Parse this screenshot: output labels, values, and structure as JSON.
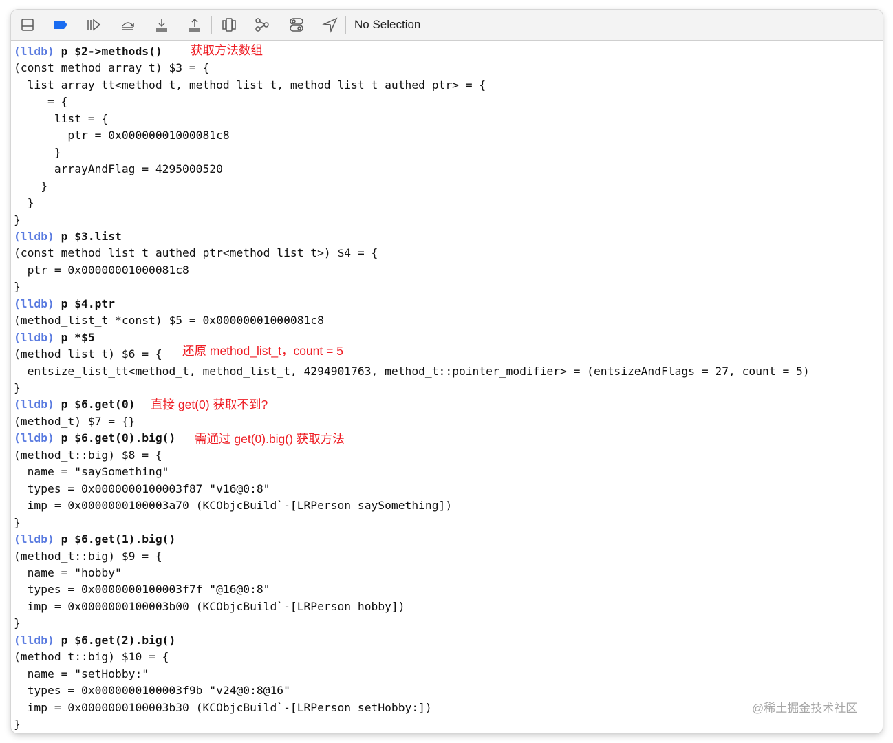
{
  "toolbar": {
    "status": "No Selection",
    "icons": [
      "hide-debug-area-icon",
      "breakpoints-toggle-icon",
      "continue-icon",
      "step-over-icon",
      "step-into-icon",
      "step-out-icon",
      "view-hierarchy-icon",
      "memory-graph-icon",
      "environment-overrides-icon",
      "simulate-location-icon"
    ]
  },
  "console": {
    "lines": [
      {
        "prompt": "(lldb)",
        "cmd": "p $2->methods()"
      },
      {
        "text": "(const method_array_t) $3 = {"
      },
      {
        "text": "  list_array_tt<method_t, method_list_t, method_list_t_authed_ptr> = {"
      },
      {
        "text": "     = {"
      },
      {
        "text": "      list = {"
      },
      {
        "text": "        ptr = 0x00000001000081c8"
      },
      {
        "text": "      }"
      },
      {
        "text": "      arrayAndFlag = 4295000520"
      },
      {
        "text": "    }"
      },
      {
        "text": "  }"
      },
      {
        "text": "}"
      },
      {
        "prompt": "(lldb)",
        "cmd": "p $3.list"
      },
      {
        "text": "(const method_list_t_authed_ptr<method_list_t>) $4 = {"
      },
      {
        "text": "  ptr = 0x00000001000081c8"
      },
      {
        "text": "}"
      },
      {
        "prompt": "(lldb)",
        "cmd": "p $4.ptr"
      },
      {
        "text": "(method_list_t *const) $5 = 0x00000001000081c8"
      },
      {
        "prompt": "(lldb)",
        "cmd": "p *$5"
      },
      {
        "text": "(method_list_t) $6 = {"
      },
      {
        "text": "  entsize_list_tt<method_t, method_list_t, 4294901763, method_t::pointer_modifier> = (entsizeAndFlags = 27, count = 5)"
      },
      {
        "text": "}"
      },
      {
        "prompt": "(lldb)",
        "cmd": "p $6.get(0)"
      },
      {
        "text": "(method_t) $7 = {}"
      },
      {
        "prompt": "(lldb)",
        "cmd": "p $6.get(0).big()"
      },
      {
        "text": "(method_t::big) $8 = {"
      },
      {
        "text": "  name = \"saySomething\""
      },
      {
        "text": "  types = 0x0000000100003f87 \"v16@0:8\""
      },
      {
        "text": "  imp = 0x0000000100003a70 (KCObjcBuild`-[LRPerson saySomething])"
      },
      {
        "text": "}"
      },
      {
        "prompt": "(lldb)",
        "cmd": "p $6.get(1).big()"
      },
      {
        "text": "(method_t::big) $9 = {"
      },
      {
        "text": "  name = \"hobby\""
      },
      {
        "text": "  types = 0x0000000100003f7f \"@16@0:8\""
      },
      {
        "text": "  imp = 0x0000000100003b00 (KCObjcBuild`-[LRPerson hobby])"
      },
      {
        "text": "}"
      },
      {
        "prompt": "(lldb)",
        "cmd": "p $6.get(2).big()"
      },
      {
        "text": "(method_t::big) $10 = {"
      },
      {
        "text": "  name = \"setHobby:\""
      },
      {
        "text": "  types = 0x0000000100003f9b \"v24@0:8@16\""
      },
      {
        "text": "  imp = 0x0000000100003b30 (KCObjcBuild`-[LRPerson setHobby:])"
      },
      {
        "text": "}"
      }
    ]
  },
  "annotations": {
    "get_methods": "获取方法数组",
    "restore_list": "还原 method_list_t，count = 5",
    "get0_fail": "直接 get(0) 获取不到?",
    "get0_big": "需通过 get(0).big() 获取方法"
  },
  "watermark": "@稀土掘金技术社区",
  "colors": {
    "prompt": "#5a7be0",
    "annotation": "#ee1d24",
    "toolbar_accent": "#1a6cf0"
  }
}
